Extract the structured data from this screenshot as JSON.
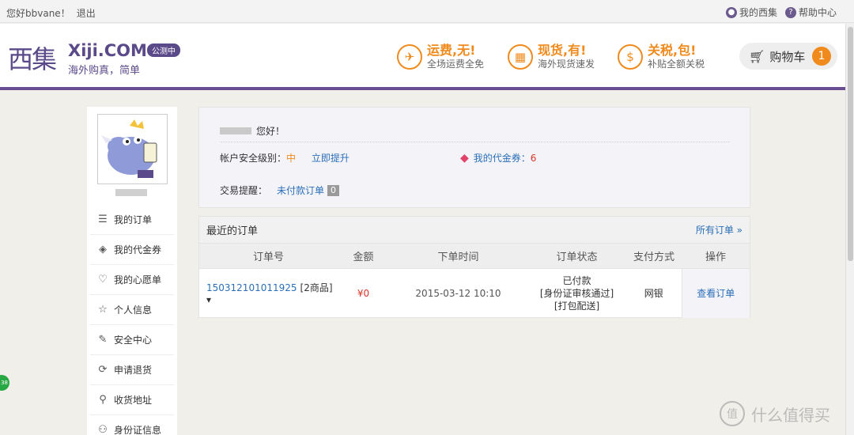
{
  "topbar": {
    "greeting": "您好bbvane！",
    "logout": "退出",
    "my_xiji": "我的西集",
    "help": "帮助中心"
  },
  "header": {
    "logo_cn": "西集",
    "logo_en": "Xiji.COM",
    "logo_badge": "公测中",
    "logo_slogan": "海外购真，简单",
    "promos": [
      {
        "title": "运费,无!",
        "sub": "全场运费全免",
        "icon": "plane-icon"
      },
      {
        "title": "现货,有!",
        "sub": "海外现货速发",
        "icon": "gift-icon"
      },
      {
        "title": "关税,包!",
        "sub": "补贴全额关税",
        "icon": "dollar-icon"
      }
    ],
    "cart_label": "购物车",
    "cart_count": "1"
  },
  "sidebar": {
    "items": [
      {
        "label": "我的订单",
        "icon": "order-list-icon"
      },
      {
        "label": "我的代金券",
        "icon": "tag-icon"
      },
      {
        "label": "我的心愿单",
        "icon": "heart-icon"
      },
      {
        "label": "个人信息",
        "icon": "star-icon"
      },
      {
        "label": "安全中心",
        "icon": "edit-icon"
      },
      {
        "label": "申请退货",
        "icon": "refresh-icon"
      },
      {
        "label": "收货地址",
        "icon": "location-icon"
      },
      {
        "label": "身份证信息",
        "icon": "id-card-icon"
      }
    ]
  },
  "info": {
    "hello": "您好！",
    "security_label": "帐户安全级别：",
    "security_level": "中",
    "improve_link": "立即提升",
    "coupon_label": "我的代金券：",
    "coupon_count": "6",
    "remind_label": "交易提醒：",
    "unpaid_label": "未付款订单",
    "unpaid_count": "0"
  },
  "orders": {
    "title": "最近的订单",
    "all_link": "所有订单 »",
    "columns": [
      "订单号",
      "金额",
      "下单时间",
      "订单状态",
      "支付方式",
      "操作"
    ],
    "rows": [
      {
        "order_id": "150312101011925",
        "items": "[2商品]",
        "amount": "¥0",
        "time": "2015-03-12 10:10",
        "status": [
          "已付款",
          "[身份证审核通过]",
          "[打包配送]"
        ],
        "payment": "网银",
        "action": "查看订单"
      }
    ]
  },
  "misc": {
    "green_badge": "38",
    "watermark": "什么值得买"
  },
  "colors": {
    "brand_purple": "#5b4a8a",
    "accent_orange": "#f08a1c",
    "link_blue": "#2a6fb8",
    "price_red": "#d9342b"
  }
}
